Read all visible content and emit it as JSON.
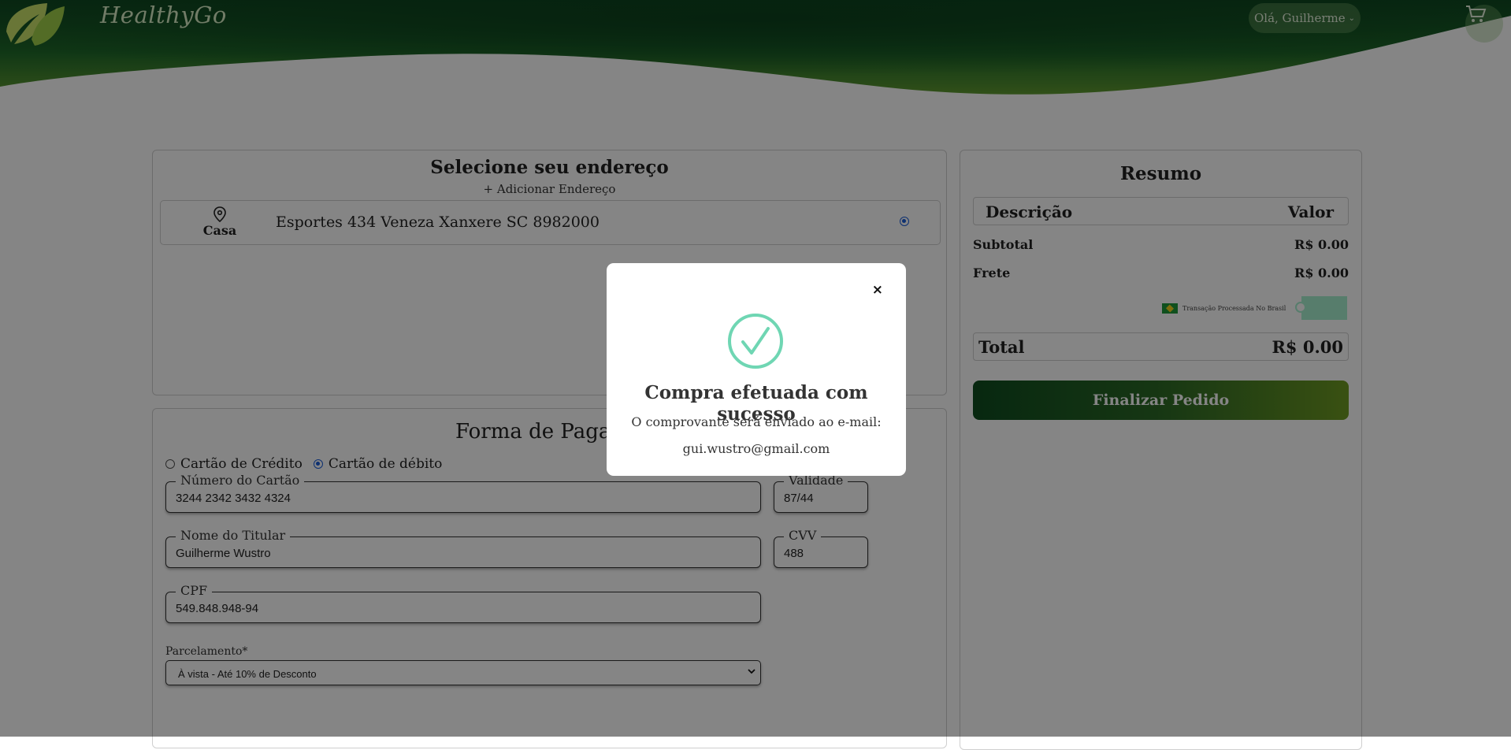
{
  "header": {
    "brand": "HealthyGo",
    "greeting": "Olá, Guilherme",
    "colors": {
      "dark_green": "#0f4a22",
      "mid_green": "#2d7a2f",
      "light_green": "#6aa032"
    }
  },
  "address": {
    "title": "Selecione seu endereço",
    "add_label": "+ Adicionar Endereço",
    "items": [
      {
        "label": "Casa",
        "text": "Esportes 434 Veneza Xanxere SC 8982000",
        "selected": true
      }
    ]
  },
  "payment": {
    "title": "Forma de Pagamento",
    "options": [
      {
        "label": "Cartão de Crédito",
        "selected": false
      },
      {
        "label": "Cartão de débito",
        "selected": true
      }
    ],
    "card_number": {
      "label": "Número do Cartão",
      "value": "3244 2342 3432 4324"
    },
    "validity": {
      "label": "Validade",
      "value": "87/44"
    },
    "holder": {
      "label": "Nome do Titular",
      "value": "Guilherme Wustro"
    },
    "cvv": {
      "label": "CVV",
      "value": "488"
    },
    "cpf": {
      "label": "CPF",
      "value": "549.848.948-94"
    },
    "installments": {
      "label": "Parcelamento*",
      "value": "À vista - Até 10% de Desconto"
    }
  },
  "summary": {
    "title": "Resumo",
    "head_desc": "Descrição",
    "head_value": "Valor",
    "subtotal_label": "Subtotal",
    "subtotal_value": "R$ 0.00",
    "freight_label": "Frete",
    "freight_value": "R$ 0.00",
    "secure_text": "Transação Processada No Brasil",
    "total_label": "Total",
    "total_value": "R$ 0.00",
    "finalize_label": "Finalizar Pedido"
  },
  "modal": {
    "close": "×",
    "title": "Compra efetuada com sucesso",
    "text": "O comprovante será enviado ao e-mail:",
    "email": "gui.wustro@gmail.com",
    "check_color": "#6fd6b3"
  }
}
